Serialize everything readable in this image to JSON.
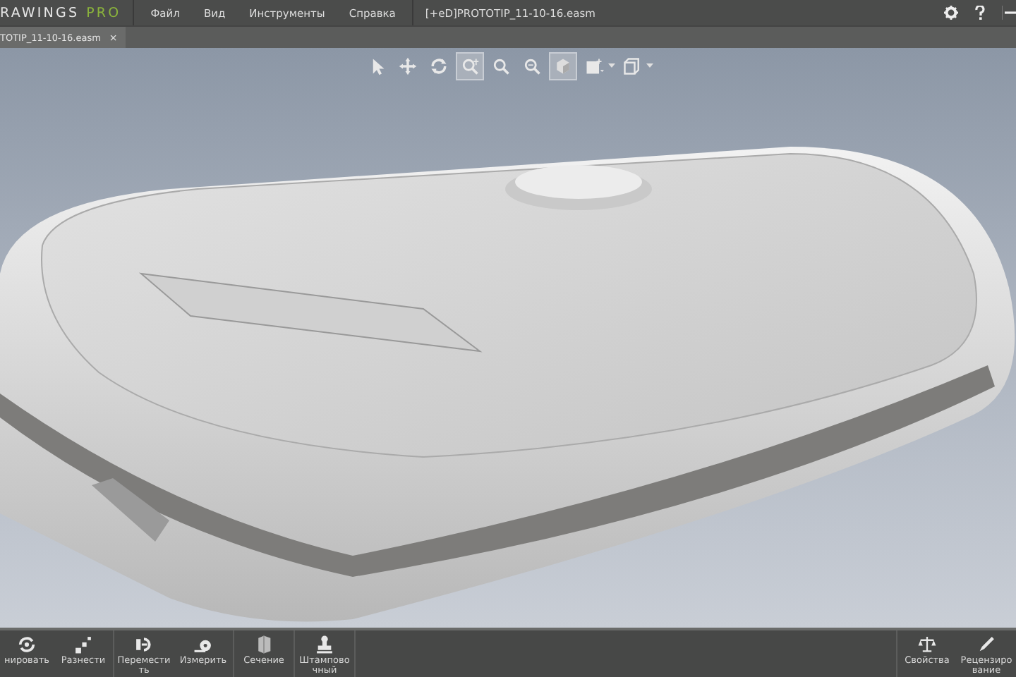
{
  "app": {
    "logo": "RAWINGS",
    "logo_suffix": "PRO"
  },
  "menu": [
    "Файл",
    "Вид",
    "Инструменты",
    "Справка"
  ],
  "document_title": "[+eD]PROTOTIP_11-10-16.easm",
  "tabs": [
    {
      "label": "TOTIP_11-10-16.easm",
      "close": "×",
      "selected": true
    }
  ],
  "view_toolbar": [
    {
      "kind": "select",
      "selected": false
    },
    {
      "kind": "pan",
      "selected": false
    },
    {
      "kind": "rotate",
      "selected": false
    },
    {
      "kind": "zoom-area",
      "selected": true
    },
    {
      "kind": "zoom",
      "selected": false
    },
    {
      "kind": "zoom-fit",
      "selected": false
    },
    {
      "kind": "display",
      "selected": true
    },
    {
      "kind": "shaded",
      "selected": false
    },
    {
      "kind": "outline",
      "selected": false
    }
  ],
  "bottom_toolbar": {
    "left_groups": [
      [
        {
          "kind": "animate",
          "label": "нировать"
        },
        {
          "kind": "explode",
          "label": "Разнести"
        }
      ],
      [
        {
          "kind": "move",
          "label": "Переместить"
        },
        {
          "kind": "measure",
          "label": "Измерить"
        }
      ],
      [
        {
          "kind": "section",
          "label": "Сечение"
        }
      ],
      [
        {
          "kind": "stamp",
          "label": "Штамповочный"
        }
      ]
    ],
    "right_groups": [
      [
        {
          "kind": "properties",
          "label": "Свойства"
        },
        {
          "kind": "markup",
          "label": "Рецензирование"
        }
      ]
    ]
  }
}
